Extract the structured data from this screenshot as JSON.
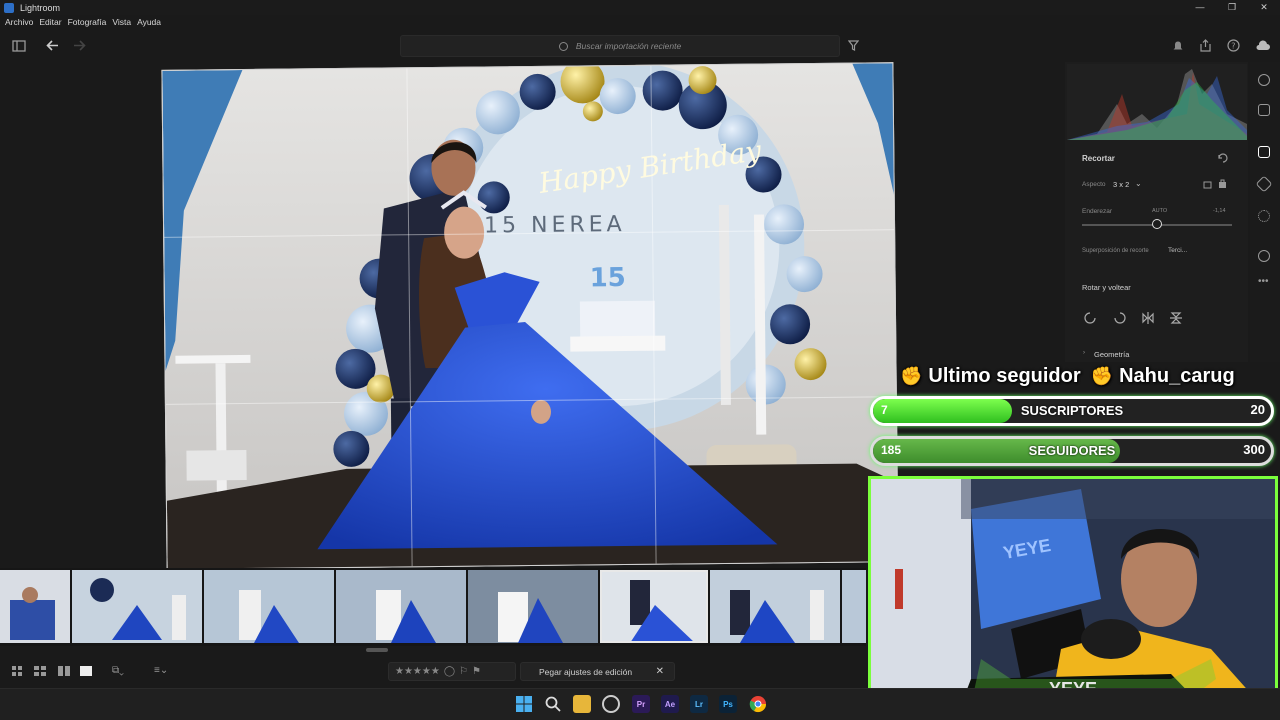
{
  "window": {
    "title": "Lightroom",
    "controls": [
      "—",
      "❐",
      "✕"
    ]
  },
  "menu": [
    "Archivo",
    "Editar",
    "Fotografía",
    "Vista",
    "Ayuda"
  ],
  "search": {
    "placeholder": "Buscar importación reciente"
  },
  "panel": {
    "section": "Recortar",
    "aspect_label": "Aspecto",
    "aspect_value": "3 x 2",
    "straighten_label": "Enderezar",
    "straighten_auto": "AUTO",
    "straighten_value": "-1,14",
    "overlay_label": "Superposición de recorte",
    "overlay_value": "Terci...",
    "rotate_label": "Rotar y voltear",
    "geometry_label": "Geometría"
  },
  "stream": {
    "last_follower_label": "Ultimo seguidor",
    "last_follower_name": "Nahu_carug",
    "subs": {
      "current": "7",
      "label": "SUSCRIPTORES",
      "goal": "20",
      "progress": 0.35
    },
    "followers": {
      "current": "185",
      "label": "SEGUIDORES",
      "goal": "300",
      "progress": 0.62
    },
    "cam_text": "YEYE",
    "cam_footer": "YEYE"
  },
  "bottom": {
    "paste_label": "Pegar ajustes de edición"
  },
  "colors": {
    "accent_green": "#7bff3c",
    "lightroom_blue": "#2d6fc7",
    "gown_blue": "#1f49c8"
  }
}
